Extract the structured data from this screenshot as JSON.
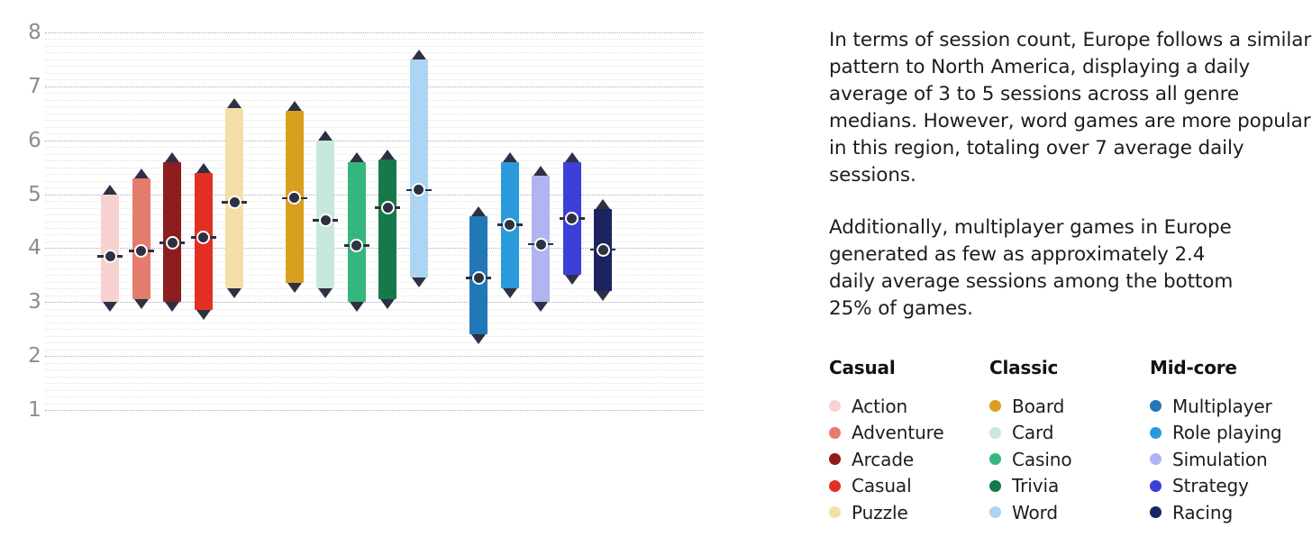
{
  "chart_data": {
    "type": "bar",
    "subtype": "range-bar-with-median",
    "title": "",
    "xlabel": "",
    "ylabel": "",
    "ylim": [
      1,
      8
    ],
    "yticks": [
      1,
      2,
      3,
      4,
      5,
      6,
      7,
      8
    ],
    "ytick_labels": [
      "1",
      "2",
      "3",
      "4",
      "5",
      "6",
      "7",
      "8"
    ],
    "grid": true,
    "legend_position": "right",
    "categories": [
      "Action",
      "Adventure",
      "Arcade",
      "Casual",
      "Puzzle",
      "Board",
      "Card",
      "Casino",
      "Trivia",
      "Word",
      "Multiplayer",
      "Role playing",
      "Simulation",
      "Strategy",
      "Racing"
    ],
    "series": [
      {
        "name": "upper",
        "values": [
          5.0,
          5.3,
          5.6,
          5.4,
          6.6,
          6.55,
          6.0,
          5.6,
          5.65,
          7.5,
          4.6,
          5.6,
          5.35,
          5.6,
          4.72
        ]
      },
      {
        "name": "median",
        "values": [
          3.85,
          3.95,
          4.1,
          4.2,
          4.85,
          4.93,
          4.52,
          4.05,
          4.75,
          5.08,
          3.45,
          4.43,
          4.07,
          4.55,
          3.97
        ]
      },
      {
        "name": "lower",
        "values": [
          3.0,
          3.05,
          3.0,
          2.85,
          3.25,
          3.35,
          3.25,
          3.0,
          3.05,
          3.45,
          2.4,
          3.25,
          3.0,
          3.5,
          3.2
        ]
      }
    ],
    "bars": [
      {
        "label": "Action",
        "group": "Casual",
        "upper": 5.0,
        "median": 3.85,
        "lower": 3.0,
        "color": "#f7d2d0"
      },
      {
        "label": "Adventure",
        "group": "Casual",
        "upper": 5.3,
        "median": 3.95,
        "lower": 3.05,
        "color": "#e57b6d"
      },
      {
        "label": "Arcade",
        "group": "Casual",
        "upper": 5.6,
        "median": 4.1,
        "lower": 3.0,
        "color": "#8e1d1d"
      },
      {
        "label": "Casual",
        "group": "Casual",
        "upper": 5.4,
        "median": 4.2,
        "lower": 2.85,
        "color": "#e22f24"
      },
      {
        "label": "Puzzle",
        "group": "Casual",
        "upper": 6.6,
        "median": 4.85,
        "lower": 3.25,
        "color": "#f5dfa8"
      },
      {
        "label": "Board",
        "group": "Classic",
        "upper": 6.55,
        "median": 4.93,
        "lower": 3.35,
        "color": "#d8a01e"
      },
      {
        "label": "Card",
        "group": "Classic",
        "upper": 6.0,
        "median": 4.52,
        "lower": 3.25,
        "color": "#c6e9dc"
      },
      {
        "label": "Casino",
        "group": "Classic",
        "upper": 5.6,
        "median": 4.05,
        "lower": 3.0,
        "color": "#35b67f"
      },
      {
        "label": "Trivia",
        "group": "Classic",
        "upper": 5.65,
        "median": 4.75,
        "lower": 3.05,
        "color": "#15794a"
      },
      {
        "label": "Word",
        "group": "Classic",
        "upper": 7.5,
        "median": 5.08,
        "lower": 3.45,
        "color": "#abd5f2"
      },
      {
        "label": "Multiplayer",
        "group": "Mid-core",
        "upper": 4.6,
        "median": 3.45,
        "lower": 2.4,
        "color": "#2277b8"
      },
      {
        "label": "Role playing",
        "group": "Mid-core",
        "upper": 5.6,
        "median": 4.43,
        "lower": 3.25,
        "color": "#2b9ada"
      },
      {
        "label": "Simulation",
        "group": "Mid-core",
        "upper": 5.35,
        "median": 4.07,
        "lower": 3.0,
        "color": "#b0b4f0"
      },
      {
        "label": "Strategy",
        "group": "Mid-core",
        "upper": 5.6,
        "median": 4.55,
        "lower": 3.5,
        "color": "#3b3fd8"
      },
      {
        "label": "Racing",
        "group": "Mid-core",
        "upper": 4.72,
        "median": 3.97,
        "lower": 3.2,
        "color": "#1b2460"
      }
    ],
    "marker_color": "#2d3142",
    "gridline_color": "#9aa0ac",
    "minor_gridline_color": "#e2e0e4",
    "axis_label_color": "#8b8b90"
  },
  "commentary": {
    "paragraph_1": "In terms of session count, Europe follows a similar pattern to North America, displaying a daily average of 3 to 5 sessions across all genre medians. However, word games are more popular in this region, totaling over 7 average daily sessions.",
    "paragraph_2": "Additionally, multiplayer games in Europe generated as few as approximately 2.4 daily average sessions among the bottom 25% of games."
  },
  "legend": {
    "columns": [
      {
        "title": "Casual",
        "items": [
          {
            "label": "Action",
            "color": "#f7d2d0"
          },
          {
            "label": "Adventure",
            "color": "#e57b6d"
          },
          {
            "label": "Arcade",
            "color": "#8e1d1d"
          },
          {
            "label": "Casual",
            "color": "#e22f24"
          },
          {
            "label": "Puzzle",
            "color": "#f5dfa8"
          }
        ]
      },
      {
        "title": "Classic",
        "items": [
          {
            "label": "Board",
            "color": "#d8a01e"
          },
          {
            "label": "Card",
            "color": "#c6e9dc"
          },
          {
            "label": "Casino",
            "color": "#35b67f"
          },
          {
            "label": "Trivia",
            "color": "#15794a"
          },
          {
            "label": "Word",
            "color": "#abd5f2"
          }
        ]
      },
      {
        "title": "Mid-core",
        "items": [
          {
            "label": "Multiplayer",
            "color": "#2277b8"
          },
          {
            "label": "Role playing",
            "color": "#2b9ada"
          },
          {
            "label": "Simulation",
            "color": "#b0b4f0"
          },
          {
            "label": "Strategy",
            "color": "#3b3fd8"
          },
          {
            "label": "Racing",
            "color": "#1b2460"
          }
        ]
      }
    ]
  }
}
